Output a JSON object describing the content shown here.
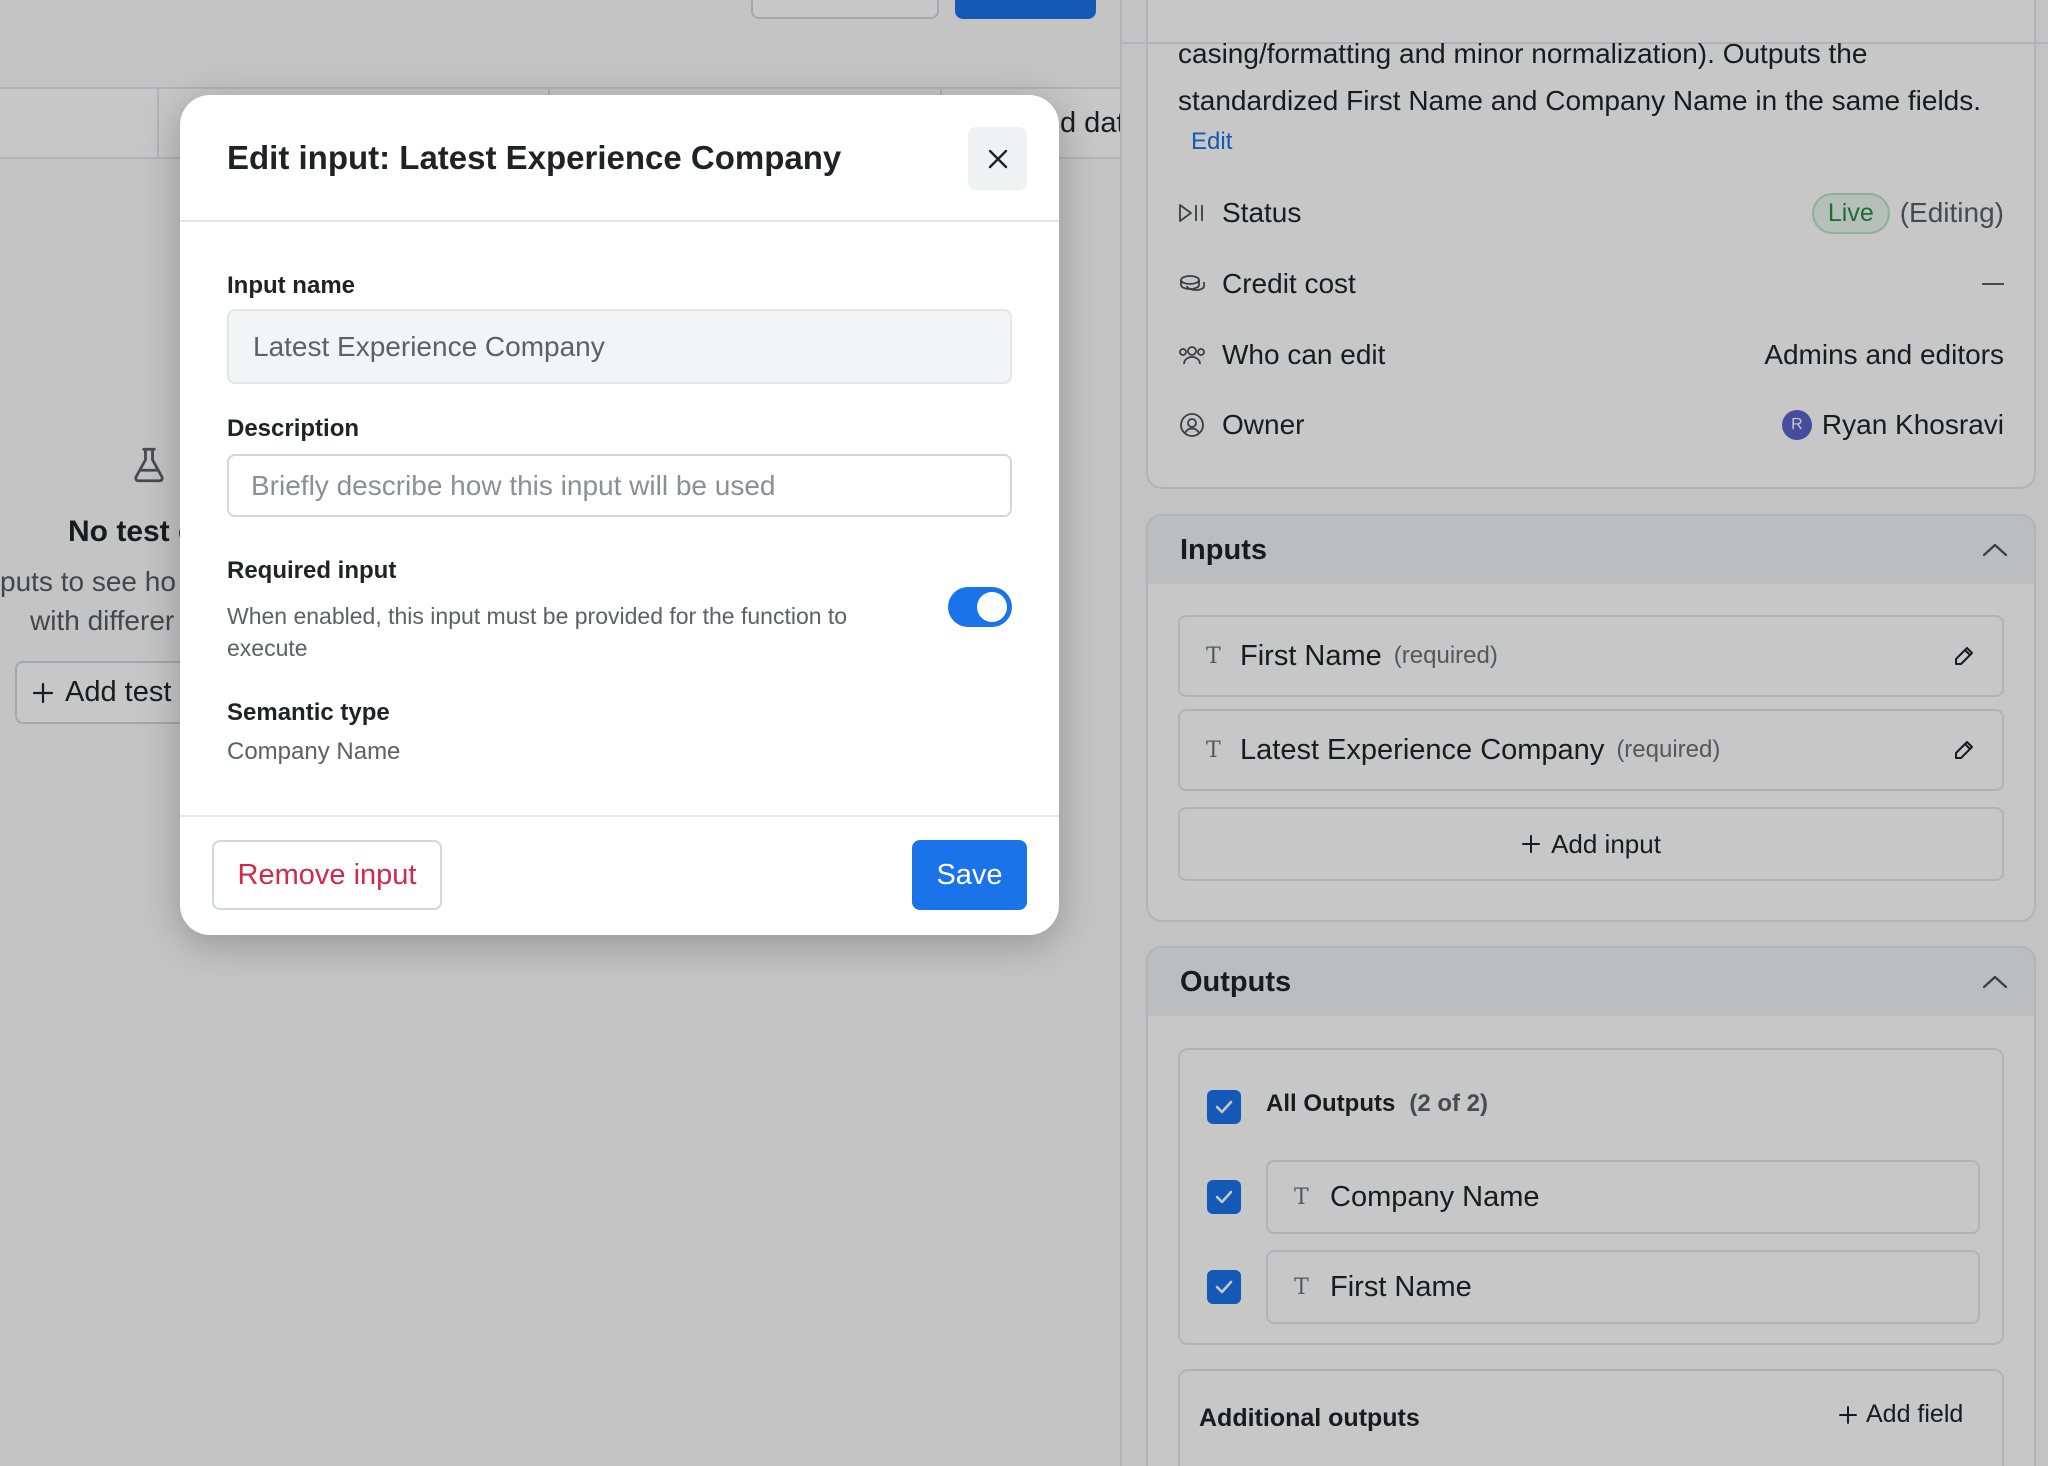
{
  "background": {
    "table_header_text": "d dat",
    "empty_state": {
      "title": "No test c",
      "desc_line1": "puts to see ho",
      "desc_line2": "with differer",
      "add_test_label": "Add test"
    }
  },
  "about": {
    "description": "casing/formatting and minor normalization). Outputs the standardized First Name and Company Name in the same fields.",
    "edit_label": "Edit",
    "status_label": "Status",
    "status_badge": "Live",
    "status_note": "(Editing)",
    "credit_label": "Credit cost",
    "who_label": "Who can edit",
    "who_value": "Admins and editors",
    "owner_label": "Owner",
    "owner_initial": "R",
    "owner_name": "Ryan Khosravi"
  },
  "inputs": {
    "title": "Inputs",
    "items": [
      {
        "type_icon": "T",
        "name": "First Name",
        "required": "(required)"
      },
      {
        "type_icon": "T",
        "name": "Latest Experience Company",
        "required": "(required)"
      }
    ],
    "add_label": "Add input"
  },
  "outputs": {
    "title": "Outputs",
    "all_label": "All Outputs",
    "all_count": "(2 of 2)",
    "items": [
      {
        "type_icon": "T",
        "name": "Company Name"
      },
      {
        "type_icon": "T",
        "name": "First Name"
      }
    ],
    "additional_label": "Additional outputs",
    "add_field_label": "Add field"
  },
  "modal": {
    "title": "Edit input: Latest Experience Company",
    "input_name_label": "Input name",
    "input_name_value": "Latest Experience Company",
    "description_label": "Description",
    "description_placeholder": "Briefly describe how this input will be used",
    "required_label": "Required input",
    "required_help": "When enabled, this input must be provided for the function to execute",
    "required_enabled": true,
    "semantic_label": "Semantic type",
    "semantic_value": "Company Name",
    "remove_label": "Remove input",
    "save_label": "Save"
  },
  "colors": {
    "accent": "#1a73e8",
    "danger": "#d1294b",
    "live_green": "#2b8a4a"
  }
}
